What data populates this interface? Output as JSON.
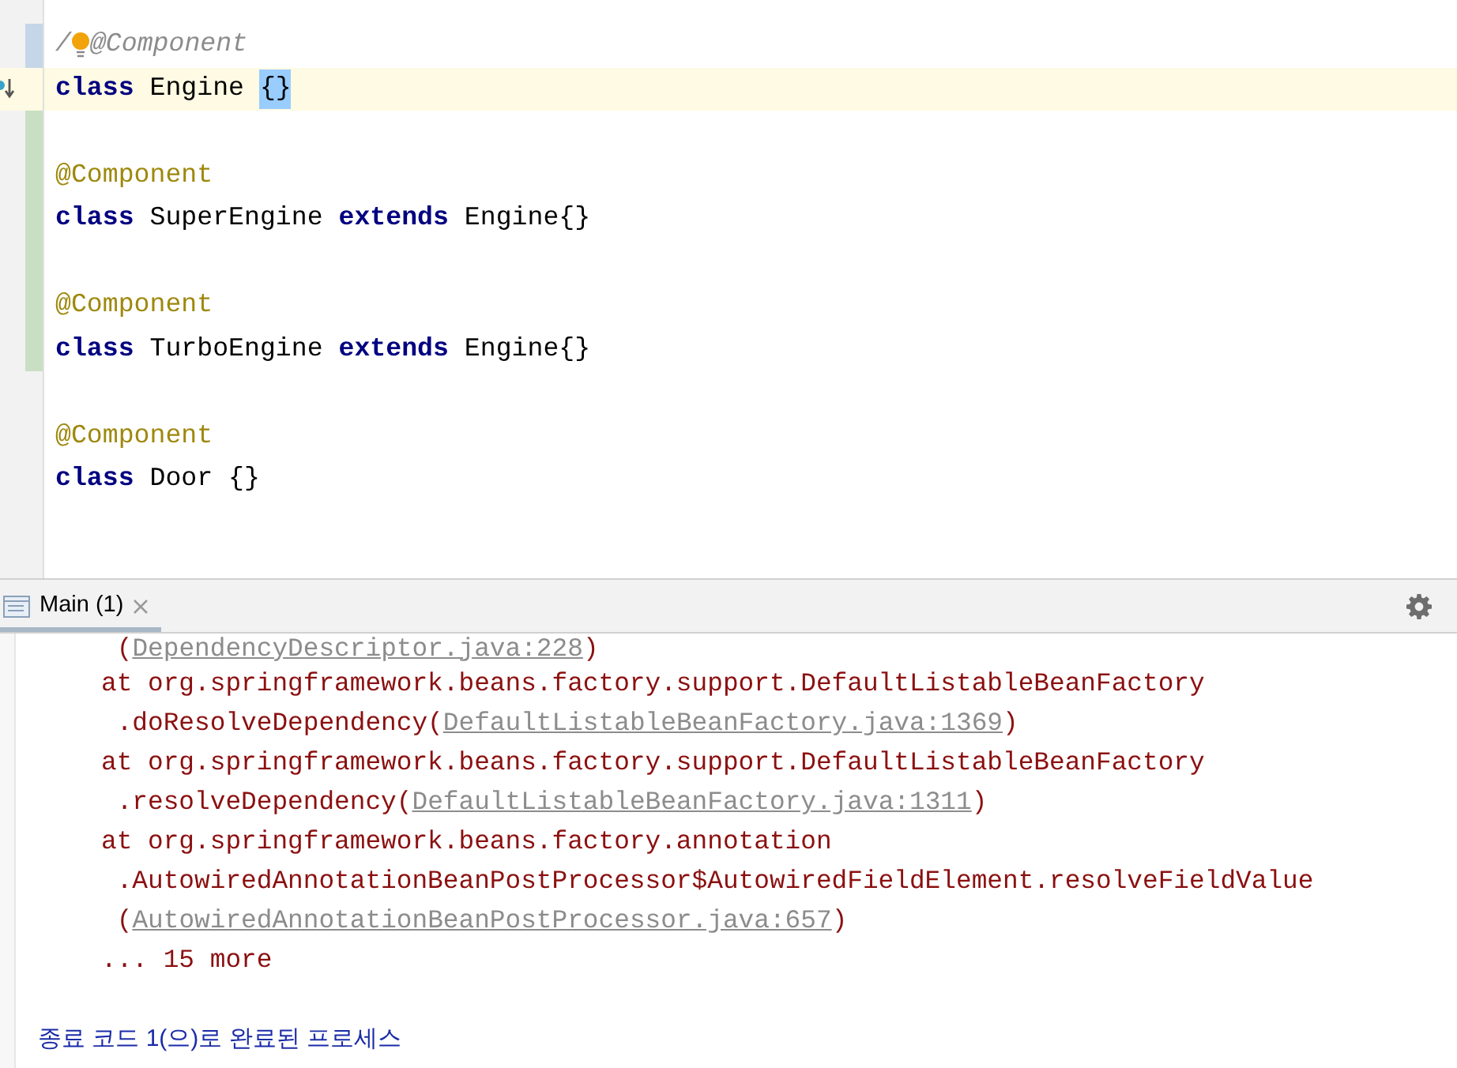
{
  "editor": {
    "lines": [
      {
        "kind": "code",
        "change": {
          "kind": "modified"
        },
        "tokens": [
          {
            "kind": "comment",
            "text": "/"
          },
          {
            "kind": "bulb"
          },
          {
            "kind": "comment",
            "text": "@Component"
          }
        ]
      },
      {
        "kind": "code",
        "current": true,
        "implementation_marker": true,
        "tokens": [
          {
            "kind": "keyword",
            "text": "class"
          },
          {
            "kind": "plain",
            "text": " Engine "
          },
          {
            "kind": "match",
            "text": "{}"
          }
        ]
      },
      {
        "kind": "blank",
        "change": {
          "kind": "added"
        }
      },
      {
        "kind": "code",
        "change": {
          "kind": "added"
        },
        "tokens": [
          {
            "kind": "annotation",
            "text": "@Component"
          }
        ]
      },
      {
        "kind": "code",
        "change": {
          "kind": "added"
        },
        "tokens": [
          {
            "kind": "keyword",
            "text": "class"
          },
          {
            "kind": "plain",
            "text": " SuperEngine "
          },
          {
            "kind": "keyword",
            "text": "extends"
          },
          {
            "kind": "plain",
            "text": " Engine{}"
          }
        ]
      },
      {
        "kind": "blank",
        "change": {
          "kind": "added"
        }
      },
      {
        "kind": "code",
        "change": {
          "kind": "added"
        },
        "tokens": [
          {
            "kind": "annotation",
            "text": "@Component"
          }
        ]
      },
      {
        "kind": "code",
        "change": {
          "kind": "added"
        },
        "tokens": [
          {
            "kind": "keyword",
            "text": "class"
          },
          {
            "kind": "plain",
            "text": " TurboEngine "
          },
          {
            "kind": "keyword",
            "text": "extends"
          },
          {
            "kind": "plain",
            "text": " Engine{}"
          }
        ]
      },
      {
        "kind": "blank"
      },
      {
        "kind": "code",
        "tokens": [
          {
            "kind": "annotation",
            "text": "@Component"
          }
        ]
      },
      {
        "kind": "code",
        "tokens": [
          {
            "kind": "keyword",
            "text": "class"
          },
          {
            "kind": "plain",
            "text": " Door {}"
          }
        ]
      }
    ]
  },
  "run_panel": {
    "tabs": [
      {
        "label": "Main (1)",
        "selected": true
      }
    ],
    "console": [
      {
        "kind": "error",
        "segments": [
          {
            "kind": "text",
            "text": " ("
          },
          {
            "kind": "link",
            "text": "DependencyDescriptor.java:228"
          },
          {
            "kind": "text",
            "text": ")"
          }
        ]
      },
      {
        "kind": "error",
        "segments": [
          {
            "kind": "text",
            "text": "at org.springframework.beans.factory.support.DefaultListableBeanFactory"
          }
        ]
      },
      {
        "kind": "error",
        "segments": [
          {
            "kind": "text",
            "text": " .doResolveDependency("
          },
          {
            "kind": "link",
            "text": "DefaultListableBeanFactory.java:1369"
          },
          {
            "kind": "text",
            "text": ")"
          }
        ]
      },
      {
        "kind": "error",
        "segments": [
          {
            "kind": "text",
            "text": "at org.springframework.beans.factory.support.DefaultListableBeanFactory"
          }
        ]
      },
      {
        "kind": "error",
        "segments": [
          {
            "kind": "text",
            "text": " .resolveDependency("
          },
          {
            "kind": "link",
            "text": "DefaultListableBeanFactory.java:1311"
          },
          {
            "kind": "text",
            "text": ")"
          }
        ]
      },
      {
        "kind": "error",
        "segments": [
          {
            "kind": "text",
            "text": "at org.springframework.beans.factory.annotation"
          }
        ]
      },
      {
        "kind": "error",
        "segments": [
          {
            "kind": "text",
            "text": " .AutowiredAnnotationBeanPostProcessor$AutowiredFieldElement.resolveFieldValue"
          }
        ]
      },
      {
        "kind": "error",
        "segments": [
          {
            "kind": "text",
            "text": " ("
          },
          {
            "kind": "link",
            "text": "AutowiredAnnotationBeanPostProcessor.java:657"
          },
          {
            "kind": "text",
            "text": ")"
          }
        ]
      },
      {
        "kind": "error",
        "segments": [
          {
            "kind": "text",
            "text": "... 15 more"
          }
        ]
      },
      {
        "kind": "blank"
      },
      {
        "kind": "info",
        "segments": [
          {
            "kind": "text",
            "text": "종료 코드 1(으)로 완료된 프로세스"
          }
        ]
      }
    ]
  }
}
